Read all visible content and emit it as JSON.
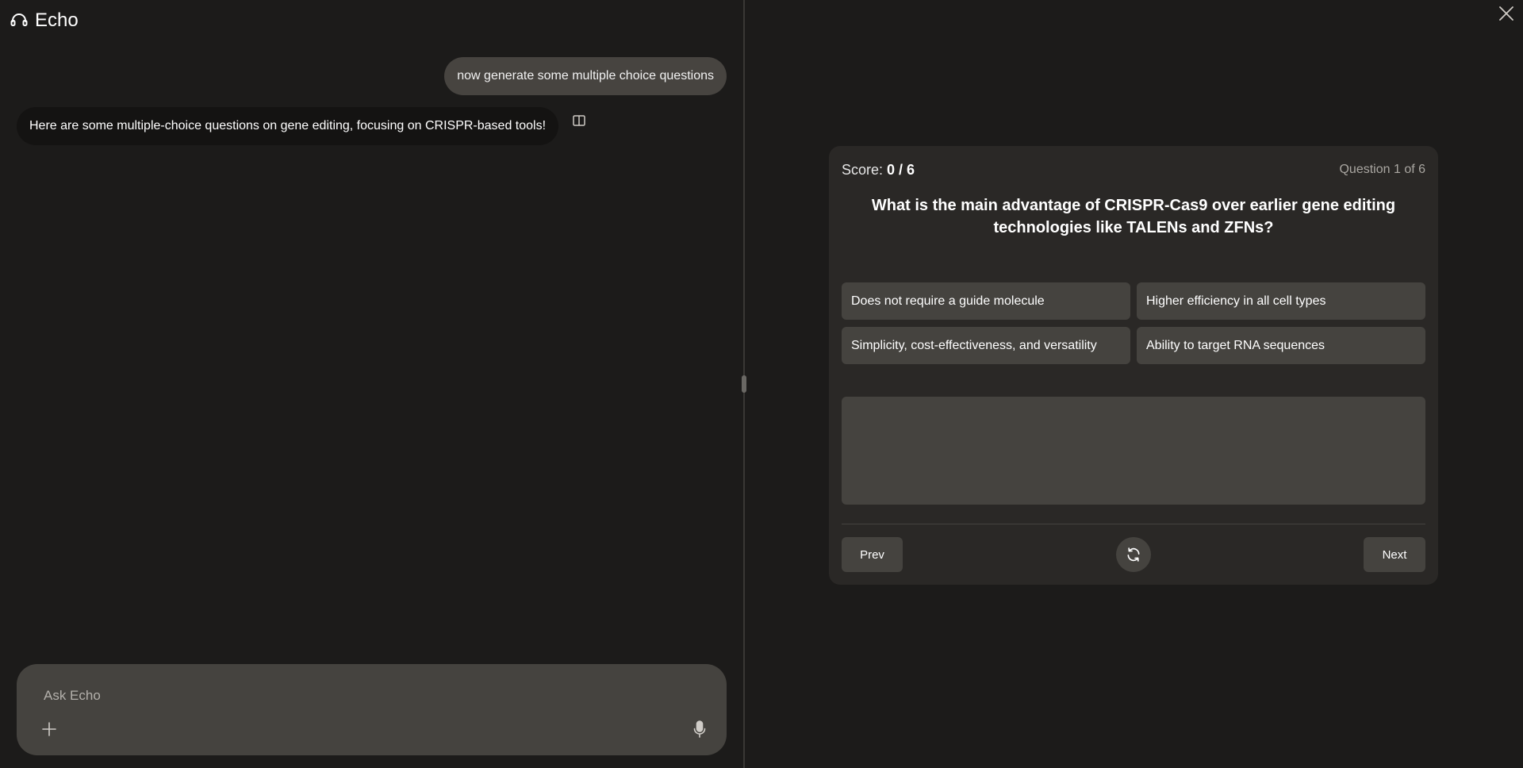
{
  "app": {
    "title": "Echo",
    "logo_icon": "headset-icon"
  },
  "chat": {
    "messages": [
      {
        "role": "user",
        "text": "now generate some multiple choice questions"
      },
      {
        "role": "assistant",
        "text": "Here are some multiple-choice questions on gene editing, focusing on CRISPR-based tools!"
      }
    ],
    "split_view_icon": "split-view-icon"
  },
  "composer": {
    "placeholder": "Ask Echo",
    "attach_icon": "plus-icon",
    "mic_icon": "microphone-icon"
  },
  "quiz": {
    "score_label": "Score:",
    "score_value": "0 / 6",
    "counter": "Question 1 of 6",
    "question": "What is the main advantage of CRISPR-Cas9 over earlier gene editing technologies like TALENs and ZFNs?",
    "options": [
      "Does not require a guide molecule",
      "Higher efficiency in all cell types",
      "Simplicity, cost-effectiveness, and versatility",
      "Ability to target RNA sequences"
    ],
    "feedback": "",
    "prev_label": "Prev",
    "next_label": "Next",
    "refresh_icon": "refresh-icon"
  },
  "colors": {
    "background": "#1c1b1a",
    "card": "#2a2826",
    "surface": "#45433f",
    "user_bubble": "#474440",
    "assistant_bubble": "#141312"
  }
}
